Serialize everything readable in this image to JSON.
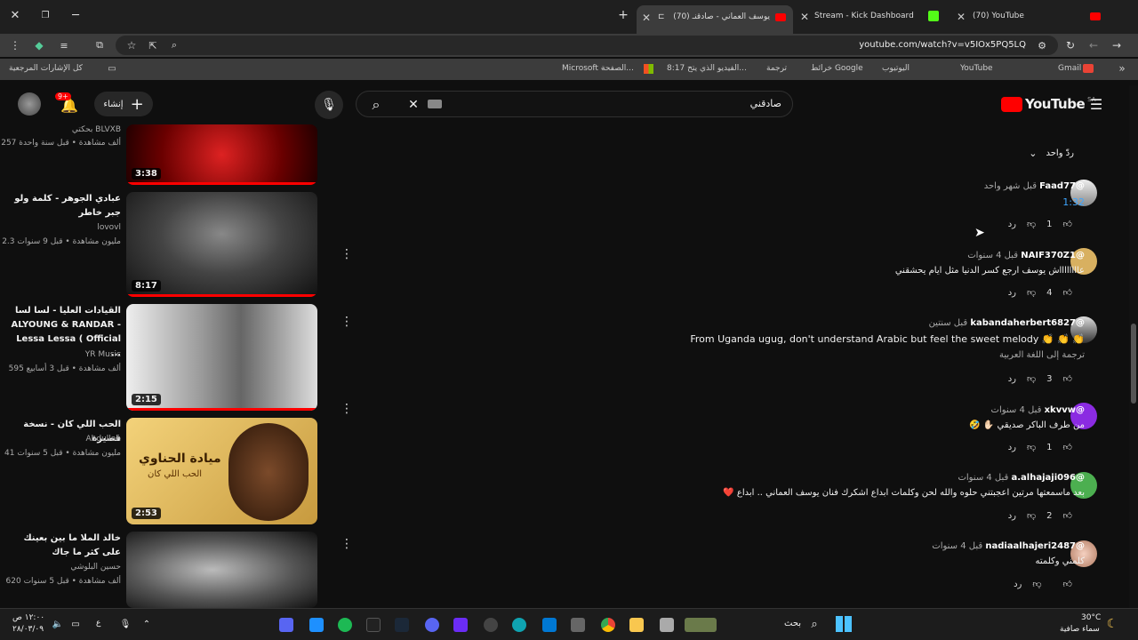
{
  "tabs": [
    {
      "label": "(70) YouTube"
    },
    {
      "label": "Stream - Kick Dashboard"
    },
    {
      "label": "(70) يوسف العماني - صادقنـ"
    }
  ],
  "url": "youtube.com/watch?v=v5IOx5PQ5LQ",
  "bookmarks": {
    "all": "كل الإشارات المرجعية",
    "items": [
      "Gmail",
      "YouTube",
      "اليوتيوب",
      "خرائط Google",
      "ترجمة",
      "8:17 الفيديو الذي يتح...",
      "الصفحة...",
      "Microsoft –"
    ]
  },
  "youtube": {
    "logo": "YouTube",
    "region": "SA",
    "search_value": "صادقني",
    "create": "إنشاء",
    "notif": "9+"
  },
  "videos": [
    {
      "title": "",
      "channel": "بحكتي BLVXB",
      "meta": "257 ألف مشاهدة • قبل سنة واحدة",
      "duration": "3:38"
    },
    {
      "title": "عبادي الجوهر - كلمة ولو جبر خاطر",
      "channel": "lovovl",
      "meta": "2.3 مليون مشاهدة • قبل 9 سنوات",
      "duration": "8:17"
    },
    {
      "title": "القيادات العليا - لسا لسا ALYOUNG & RANDAR - Lessa Lessa ( Official ...",
      "channel": "YR Music",
      "meta": "595 ألف مشاهدة • قبل 3 أسابيع",
      "duration": "2:15"
    },
    {
      "title": "الحب اللي كان - نسخة قصيرة",
      "channel": "Abdullah",
      "meta": "41 مليون مشاهدة • قبل 5 سنوات",
      "duration": "2:53"
    },
    {
      "title": "خالد الملا ما بين بعينك على كثر ما جاك",
      "channel": "حسين البلوشي",
      "meta": "620 ألف مشاهدة • قبل 5 سنوات",
      "duration": ""
    }
  ],
  "thumb_texts": {
    "album": "ميادة الحناوي",
    "album_sub": "الحب اللي كان"
  },
  "reply_toggle": "ردّ واحد",
  "comments": [
    {
      "user": "@Faad77",
      "time": "قبل شهر واحد",
      "text": "1:32",
      "likes": "1",
      "reply": "رد"
    },
    {
      "user": "@NAIF370Z1",
      "time": "قبل 4 سنوات",
      "text": "عااااااااش يوسف ارجع كسر الدنيا مثل ايام يحشقني",
      "likes": "4",
      "reply": "رد"
    },
    {
      "user": "@kabandaherbert6827",
      "time": "قبل سنتين",
      "text": "From Uganda ugug, don't understand Arabic but feel the sweet melody 👏 👏 👏",
      "translate": "ترجمة إلى اللغة العربية",
      "likes": "3",
      "reply": "رد"
    },
    {
      "user": "@xkvvw",
      "time": "قبل 4 سنوات",
      "text": "من طرف الباكر صديقي ✋🏻 🤣",
      "likes": "1",
      "reply": "رد"
    },
    {
      "user": "@a.alhajaji096",
      "time": "قبل 4 سنوات",
      "text": "بعد ماسمعتها مرتين اعجبتني حلوه والله لحن وكلمات ابداع اشكرك فنان يوسف العماني .. ابداع ❤️",
      "likes": "2",
      "reply": "رد"
    },
    {
      "user": "@nadiaalhajeri2487",
      "time": "قبل 4 سنوات",
      "text": "كلمني وكلمته",
      "likes": "",
      "reply": "رد"
    }
  ],
  "taskbar": {
    "search": "بحث",
    "weather_temp": "30°C",
    "weather_desc": "سماء صافية",
    "time": "١٢:٠٠ ص",
    "date": "٢٨/٠٣/٠٩",
    "lang": "ع"
  },
  "colors": {
    "accent": "#ff0000",
    "bg": "#0f0f0f"
  }
}
